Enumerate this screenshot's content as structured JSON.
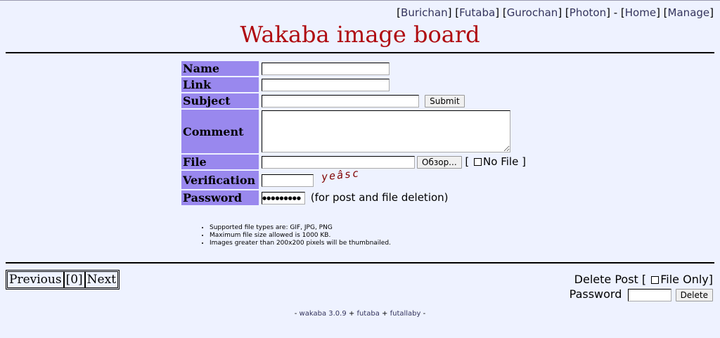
{
  "nav": {
    "boards": [
      "Burichan",
      "Futaba",
      "Gurochan",
      "Photon"
    ],
    "separator": "-",
    "home": "Home",
    "manage": "Manage"
  },
  "title": "Wakaba image board",
  "form": {
    "name_label": "Name",
    "link_label": "Link",
    "subject_label": "Subject",
    "submit_label": "Submit",
    "comment_label": "Comment",
    "file_label": "File",
    "browse_label": "Обзор...",
    "no_file_label": "No File",
    "verification_label": "Verification",
    "captcha_text": "yeâsc",
    "password_label": "Password",
    "password_value": "●●●●●●●●●",
    "password_note": "(for post and file deletion)"
  },
  "rules": [
    "Supported file types are: GIF, JPG, PNG",
    "Maximum file size allowed is 1000 KB.",
    "Images greater than 200x200 pixels will be thumbnailed."
  ],
  "pager": {
    "previous": "Previous",
    "current": "[0]",
    "next": "Next"
  },
  "delete": {
    "delete_post_label": "Delete Post",
    "file_only_label": "File Only",
    "password_label": "Password",
    "delete_button": "Delete"
  },
  "footer": {
    "prefix": "- ",
    "wakaba": "wakaba 3.0.9",
    "plus1": " + ",
    "futaba": "futaba",
    "plus2": " + ",
    "futallaby": "futallaby",
    "suffix": " -"
  },
  "colors": {
    "background": "#eef2ff",
    "title": "#af0a0f",
    "label_bg": "#9988ee",
    "link": "#34345c",
    "captcha": "#800000"
  }
}
